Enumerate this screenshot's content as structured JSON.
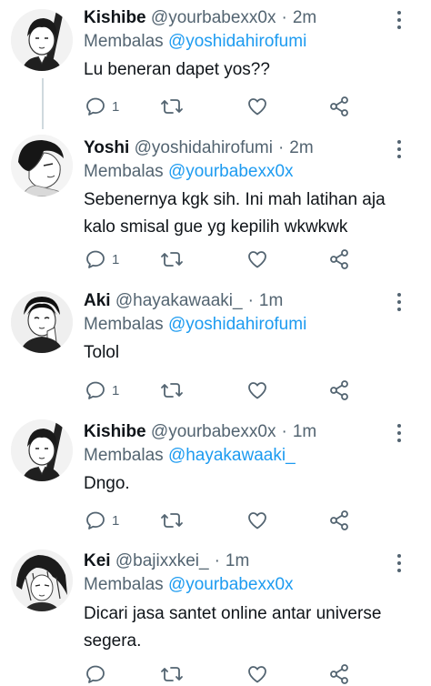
{
  "colors": {
    "link": "#1d9bf0",
    "text": "#0f1419",
    "muted": "#536471",
    "thread_line": "#cfd9de"
  },
  "tweets": [
    {
      "display_name": "Kishibe",
      "handle": "@yourbabexx0x",
      "separator": "·",
      "time": "2m",
      "reply_prefix": "Membalas",
      "reply_to": "@yoshidahirofumi",
      "text": "Lu beneran dapet yos??",
      "reply_count": "1",
      "avatar_icon": "avatar-kishibe-icon"
    },
    {
      "display_name": "Yoshi",
      "handle": "@yoshidahirofumi",
      "separator": "·",
      "time": "2m",
      "reply_prefix": "Membalas",
      "reply_to": "@yourbabexx0x",
      "text": "Sebenernya kgk sih. Ini mah latihan aja kalo smisal gue yg kepilih wkwkwk",
      "reply_count": "1",
      "avatar_icon": "avatar-yoshi-icon"
    },
    {
      "display_name": "Aki",
      "handle": "@hayakawaaki_",
      "separator": "·",
      "time": "1m",
      "reply_prefix": "Membalas",
      "reply_to": "@yoshidahirofumi",
      "text": "Tolol",
      "reply_count": "1",
      "avatar_icon": "avatar-aki-icon"
    },
    {
      "display_name": "Kishibe",
      "handle": "@yourbabexx0x",
      "separator": "·",
      "time": "1m",
      "reply_prefix": "Membalas",
      "reply_to": "@hayakawaaki_",
      "text": "Dngo.",
      "reply_count": "1",
      "avatar_icon": "avatar-kishibe-icon"
    },
    {
      "display_name": "Kei",
      "handle": "@bajixxkei_",
      "separator": "·",
      "time": "1m",
      "reply_prefix": "Membalas",
      "reply_to": "@yourbabexx0x",
      "text": "Dicari jasa santet online antar universe segera.",
      "reply_count": "",
      "avatar_icon": "avatar-kei-icon"
    }
  ]
}
